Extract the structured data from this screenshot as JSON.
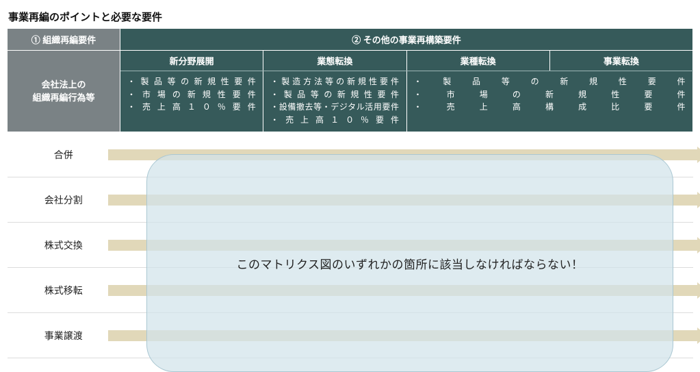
{
  "title": "事業再編のポイントと必要な要件",
  "header": {
    "col1": "①  組織再編要件",
    "col2": "②  その他の事業再構築要件",
    "leftSub": "会社法上の\n組織再編行為等"
  },
  "categories": [
    {
      "name": "新分野展開",
      "bullets": [
        "製品等の新規性要件",
        "市場の新規性要件",
        "売上高１０％要件"
      ]
    },
    {
      "name": "業態転換",
      "bullets": [
        "製造方法等の新規性要件",
        "製品等の新規性要件",
        "設備撤去等・デジタル活用要件",
        "売上高１０％要件"
      ]
    },
    {
      "name": "業種転換",
      "bullets": [
        "製品等の新規性要件",
        "市場の新規性要件",
        "売上高構成比要件"
      ]
    },
    {
      "name": "事業転換",
      "bullets": [
        "製品等の新規性要件",
        "市場の新規性要件",
        "売上高構成比要件"
      ]
    }
  ],
  "rows": [
    "合併",
    "会社分割",
    "株式交換",
    "株式移転",
    "事業譲渡"
  ],
  "overlay": "このマトリクス図のいずれかの箇所に該当しなければならない！"
}
